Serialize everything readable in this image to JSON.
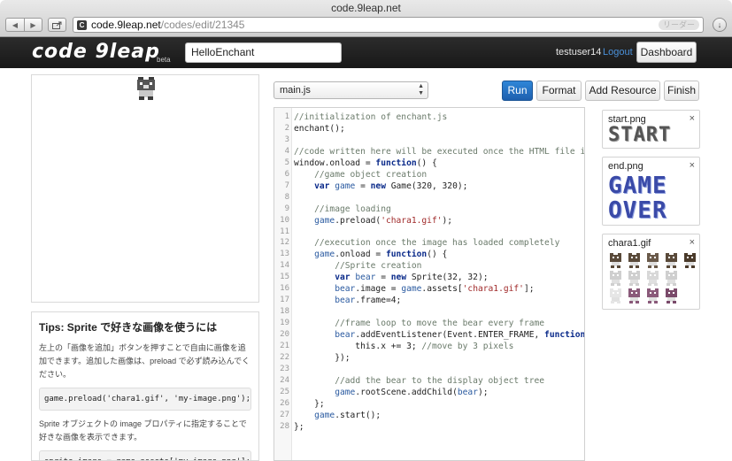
{
  "browser": {
    "window_title": "code.9leap.net",
    "url_domain": "code.9leap.net",
    "url_path": "/codes/edit/21345",
    "reader_label": "リーダー"
  },
  "header": {
    "logo_text": "code 9leap",
    "logo_badge": "beta",
    "project_title": "HelloEnchant",
    "username": "testuser14",
    "logout_label": "Logout",
    "dashboard_label": "Dashboard"
  },
  "tips": {
    "title": "Tips: Sprite で好きな画像を使うには",
    "paragraph1": "左上の「画像を追加」ボタンを押すことで自由に画像を追加できます。追加した画像は、preload で必ず読み込んでください。",
    "code1": "game.preload('chara1.gif', 'my-image.png');",
    "paragraph2": "Sprite オブジェクトの image プロパティに指定することで好きな画像を表示できます。",
    "code2": "sprite.image = game.assets['my-image.png'];"
  },
  "toolbar": {
    "file_selected": "main.js",
    "run_label": "Run",
    "format_label": "Format",
    "add_resource_label": "Add Resource",
    "finish_label": "Finish"
  },
  "code": [
    "//initialization of enchant.js",
    "enchant();",
    "",
    "//code written here will be executed once the HTML file is loaded",
    "window.onload = function() {",
    "    //game object creation",
    "    var game = new Game(320, 320);",
    "",
    "    //image loading",
    "    game.preload('chara1.gif');",
    "",
    "    //execution once the image has loaded completely",
    "    game.onload = function() {",
    "        //Sprite creation",
    "        var bear = new Sprite(32, 32);",
    "        bear.image = game.assets['chara1.gif'];",
    "        bear.frame=4;",
    "",
    "        //frame loop to move the bear every frame",
    "        bear.addEventListener(Event.ENTER_FRAME, function() {",
    "            this.x += 3; //move by 3 pixels",
    "        });",
    "",
    "        //add the bear to the display object tree",
    "        game.rootScene.addChild(bear);",
    "    };",
    "    game.start();",
    "};"
  ],
  "resources": [
    {
      "name": "start.png",
      "preview_text": "START"
    },
    {
      "name": "end.png",
      "preview_line1": "GAME",
      "preview_line2": "OVER"
    },
    {
      "name": "chara1.gif"
    }
  ],
  "colors": {
    "run_button": "#2a76c6",
    "header_bg": "#1f1f1f",
    "logout_link": "#4a90d9"
  }
}
